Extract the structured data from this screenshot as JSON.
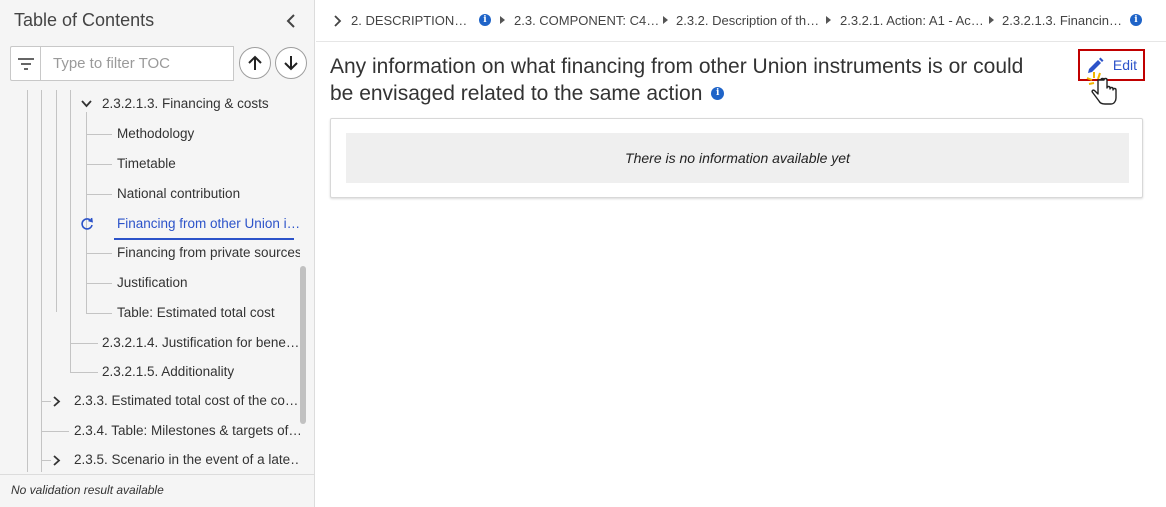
{
  "sidebar": {
    "title": "Table of Contents",
    "filter_placeholder": "Type to filter TOC",
    "status": "No validation result available",
    "nodes": [
      {
        "label": "2.3.2.1.3. Financing & costs"
      },
      {
        "label": "Methodology"
      },
      {
        "label": "Timetable"
      },
      {
        "label": "National contribution"
      },
      {
        "label": "Financing from other Union i…"
      },
      {
        "label": "Financing from private sources"
      },
      {
        "label": "Justification"
      },
      {
        "label": "Table: Estimated total cost"
      },
      {
        "label": "2.3.2.1.4. Justification for bene…"
      },
      {
        "label": "2.3.2.1.5. Additionality"
      },
      {
        "label": "2.3.3. Estimated total cost of the co…"
      },
      {
        "label": "2.3.4. Table: Milestones & targets of…"
      },
      {
        "label": "2.3.5. Scenario in the event of a late…"
      }
    ]
  },
  "breadcrumb": [
    {
      "label": "2. DESCRIPTION…"
    },
    {
      "label": "2.3. COMPONENT: C4…"
    },
    {
      "label": "2.3.2. Description of th…"
    },
    {
      "label": "2.3.2.1. Action: A1 - Ac…"
    },
    {
      "label": "2.3.2.1.3. Financin…"
    }
  ],
  "main": {
    "title": "Any information on what financing from other Union instruments is or could be envisaged related to the same action",
    "edit_label": "Edit",
    "empty_message": "There is no information available yet"
  },
  "colors": {
    "accent": "#2c53c9",
    "info": "#1f64c8",
    "highlight_border": "#c00000"
  }
}
